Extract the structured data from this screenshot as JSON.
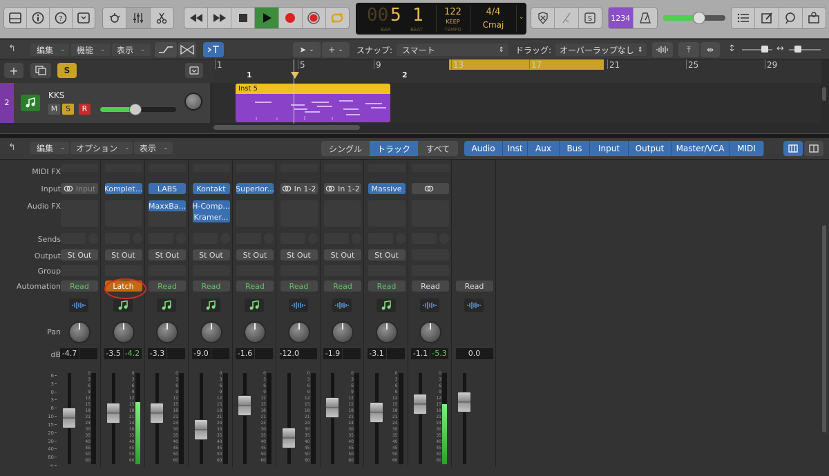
{
  "control_bar": {
    "bar": "5",
    "beat": "1",
    "bar_label": "BAR",
    "beat_label": "BEAT",
    "tempo": "122",
    "tempo_mode": "KEEP",
    "tempo_label": "TEMPO",
    "time_sig": "4/4",
    "key": "Cmaj",
    "count_in": "1234",
    "master_volume": 0.58
  },
  "tracks_toolbar": {
    "edit": "編集",
    "function": "機能",
    "view": "表示",
    "snap_label": "スナップ:",
    "snap_value": "スマート",
    "drag_label": "ドラッグ:",
    "drag_value": "オーバーラップなし"
  },
  "ruler": {
    "numbers": [
      "1",
      "5",
      "9",
      "13",
      "17",
      "21",
      "25",
      "29"
    ],
    "bars": [
      "1",
      "2"
    ]
  },
  "track": {
    "number": "2",
    "name": "KKS",
    "mute": "M",
    "solo": "S",
    "record": "R",
    "volume": 0.46,
    "region_name": "Inst 5"
  },
  "solo_button": "S",
  "mixer_toolbar": {
    "edit": "編集",
    "options": "オプション",
    "view": "表示",
    "view_modes": [
      "シングル",
      "トラック",
      "すべて"
    ],
    "active_view": "トラック",
    "filters": [
      "Audio",
      "Inst",
      "Aux",
      "Bus",
      "Input",
      "Output",
      "Master/VCA",
      "MIDI"
    ]
  },
  "mixer_labels": {
    "midi_fx": "MIDI FX",
    "input": "Input",
    "audio_fx": "Audio FX",
    "sends": "Sends",
    "output": "Output",
    "group": "Group",
    "automation": "Automation",
    "pan": "Pan",
    "db": "dB"
  },
  "fader_scale": [
    "6",
    "3",
    "0",
    "3",
    "6",
    "10",
    "15",
    "20",
    "30",
    "40",
    "60",
    "∞"
  ],
  "meter_scale": [
    "0",
    "3",
    "6",
    "9",
    "12",
    "15",
    "18",
    "21",
    "24",
    "30",
    "35",
    "40",
    "45",
    "50",
    "60"
  ],
  "strips": [
    {
      "input": "Input",
      "input_style": "link-dim",
      "audio_fx": [],
      "output": "St Out",
      "automation": "Read",
      "type": "audio",
      "db": "-4.7",
      "peak": "",
      "level": 0.5,
      "meter": 0
    },
    {
      "input": "Komplet...",
      "input_style": "blue",
      "audio_fx": [],
      "output": "St Out",
      "automation": "Latch",
      "type": "inst",
      "db": "-3.5",
      "peak": "-4.2",
      "level": 0.57,
      "meter": 0.68
    },
    {
      "input": "LABS",
      "input_style": "blue",
      "audio_fx": [
        "MaxxBa..."
      ],
      "output": "St Out",
      "automation": "Read",
      "type": "inst",
      "db": "-3.3",
      "peak": "",
      "level": 0.57,
      "meter": 0
    },
    {
      "input": "Kontakt",
      "input_style": "blue",
      "audio_fx": [
        "H-Comp...",
        "Kramer..."
      ],
      "output": "St Out",
      "automation": "Read",
      "type": "inst",
      "db": "-9.0",
      "peak": "",
      "level": 0.34,
      "meter": 0
    },
    {
      "input": "Superior...",
      "input_style": "blue",
      "audio_fx": [],
      "output": "St Out",
      "automation": "Read",
      "type": "inst",
      "db": "-1.6",
      "peak": "",
      "level": 0.67,
      "meter": 0
    },
    {
      "input": "In 1-2",
      "input_style": "link",
      "audio_fx": [],
      "output": "St Out",
      "automation": "Read",
      "type": "audio",
      "db": "-12.0",
      "peak": "",
      "level": 0.22,
      "meter": 0
    },
    {
      "input": "In 1-2",
      "input_style": "link",
      "audio_fx": [],
      "output": "St Out",
      "automation": "Read",
      "type": "audio",
      "db": "-1.9",
      "peak": "",
      "level": 0.64,
      "meter": 0
    },
    {
      "input": "Massive",
      "input_style": "blue",
      "audio_fx": [],
      "output": "St Out",
      "automation": "Read",
      "type": "inst",
      "db": "-3.1",
      "peak": "",
      "level": 0.58,
      "meter": 0
    },
    {
      "input": "",
      "input_style": "link-only",
      "audio_fx": [],
      "output": "",
      "automation": "Read",
      "type": "audio",
      "db": "-1.1",
      "peak": "-5.3",
      "level": 0.69,
      "meter": 0.66
    },
    {
      "input": "",
      "input_style": "none",
      "audio_fx": [],
      "output": "",
      "automation": "Read",
      "type": "audio",
      "db": "0.0",
      "peak": "",
      "level": 0.72,
      "meter": 0,
      "master": true
    }
  ],
  "colors": {
    "accent_blue": "#3b6fb1",
    "latch_orange": "#c26a12",
    "lcd_amber": "#e8b850",
    "region_purple": "#8a42c8",
    "region_header": "#f0c020",
    "meter_green": "#4ed04e"
  }
}
